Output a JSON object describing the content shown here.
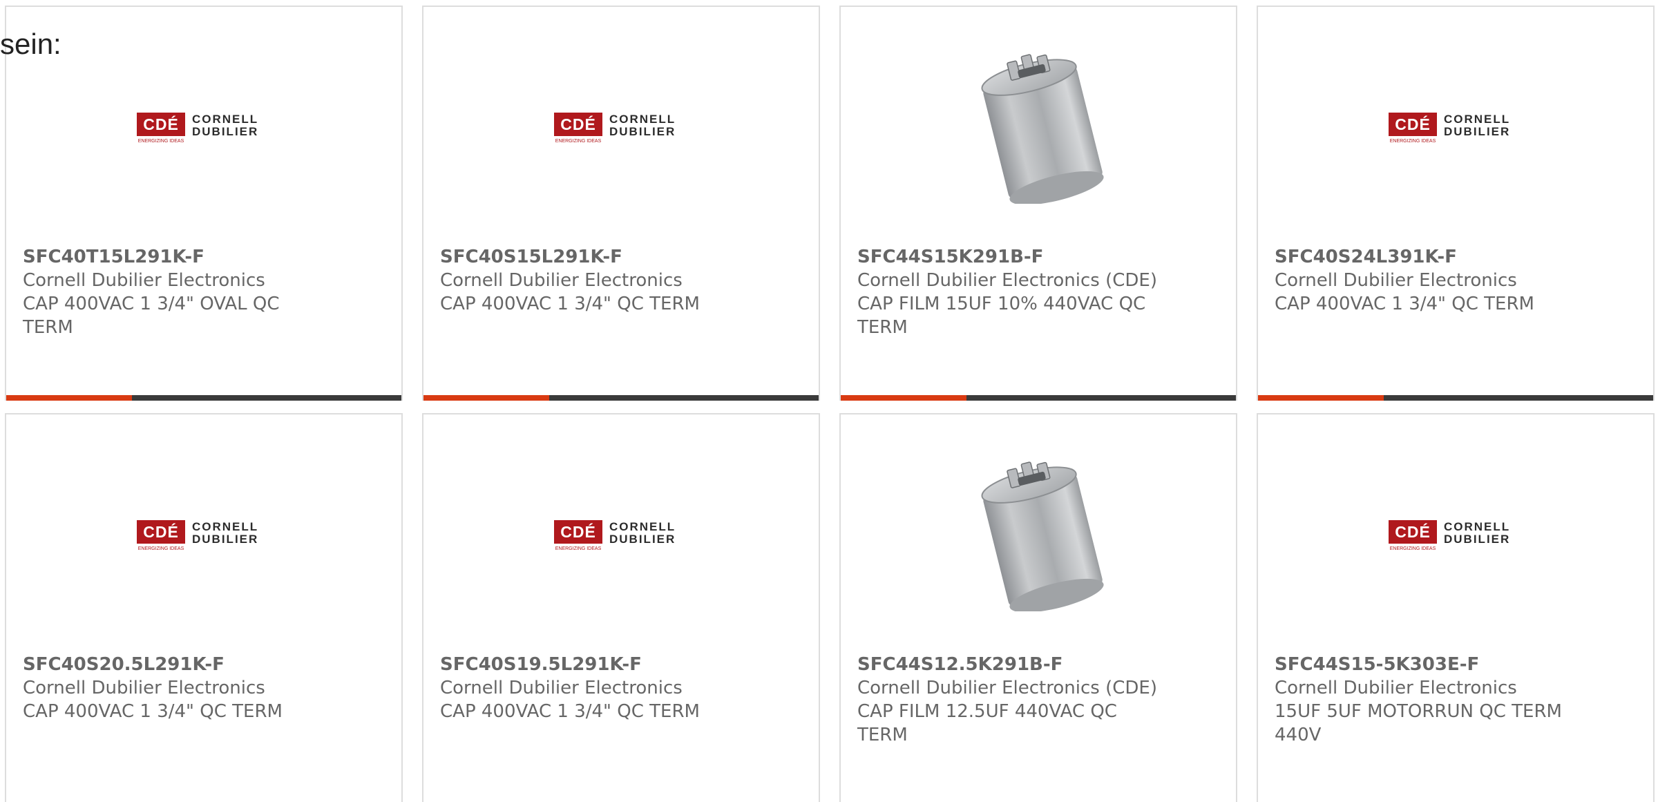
{
  "intro_text": "sein:",
  "colors": {
    "accent": "#d93a12",
    "bar_dark": "#3a3a3a",
    "logo_red": "#b0191d",
    "text_gray": "#666666"
  },
  "logo": {
    "mark": "CDÉ",
    "line1": "CORNELL",
    "line2": "DUBILIER",
    "tagline": "ENERGIZING IDEAS"
  },
  "products": [
    {
      "part_number": "SFC40T15L291K-F",
      "manufacturer": "Cornell Dubilier Electronics",
      "description": "CAP 400VAC 1 3/4\" OVAL QC TERM",
      "image": "cde-logo"
    },
    {
      "part_number": "SFC40S15L291K-F",
      "manufacturer": "Cornell Dubilier Electronics",
      "description": "CAP 400VAC 1 3/4\" QC TERM",
      "image": "cde-logo"
    },
    {
      "part_number": "SFC44S15K291B-F",
      "manufacturer": "Cornell Dubilier Electronics (CDE)",
      "description": "CAP FILM 15UF 10% 440VAC QC TERM",
      "image": "capacitor-photo"
    },
    {
      "part_number": "SFC40S24L391K-F",
      "manufacturer": "Cornell Dubilier Electronics",
      "description": "CAP 400VAC 1 3/4\" QC TERM",
      "image": "cde-logo"
    },
    {
      "part_number": "SFC40S20.5L291K-F",
      "manufacturer": "Cornell Dubilier Electronics",
      "description": "CAP 400VAC 1 3/4\" QC TERM",
      "image": "cde-logo"
    },
    {
      "part_number": "SFC40S19.5L291K-F",
      "manufacturer": "Cornell Dubilier Electronics",
      "description": "CAP 400VAC 1 3/4\" QC TERM",
      "image": "cde-logo"
    },
    {
      "part_number": "SFC44S12.5K291B-F",
      "manufacturer": "Cornell Dubilier Electronics (CDE)",
      "description": "CAP FILM 12.5UF 440VAC QC TERM",
      "image": "capacitor-photo"
    },
    {
      "part_number": "SFC44S15-5K303E-F",
      "manufacturer": "Cornell Dubilier Electronics",
      "description": "15UF 5UF MOTORRUN QC TERM 440V",
      "image": "cde-logo"
    }
  ]
}
